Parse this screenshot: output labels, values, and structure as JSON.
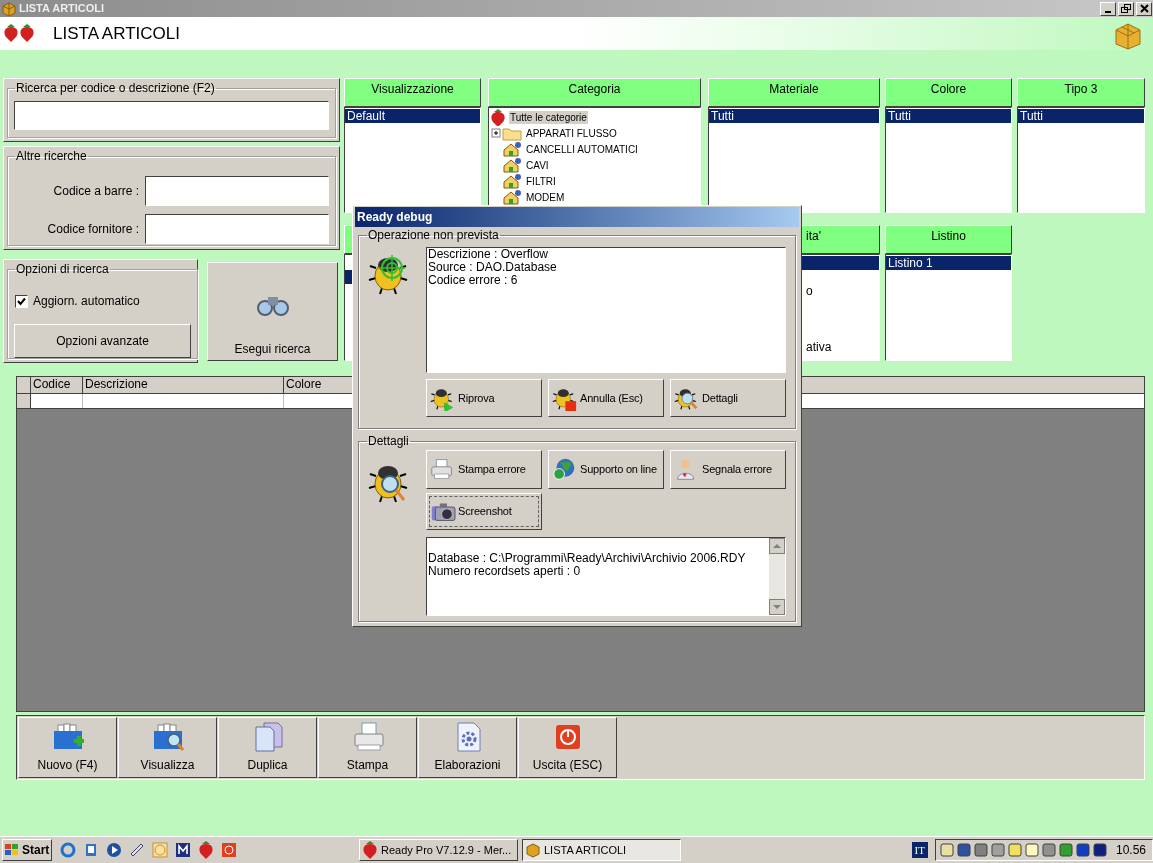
{
  "window": {
    "title": "LISTA ARTICOLI"
  },
  "header": {
    "title": "LISTA ARTICOLI"
  },
  "search": {
    "legend": "Ricerca per codice o descrizione (F2)"
  },
  "other_searches": {
    "legend": "Altre ricerche",
    "fields": [
      {
        "label": "Codice a barre :"
      },
      {
        "label": "Codice fornitore :"
      }
    ]
  },
  "search_options": {
    "legend": "Opzioni di ricerca",
    "auto_update": {
      "label": "Aggiorn. automatico",
      "checked": true
    },
    "advanced_button": "Opzioni avanzate"
  },
  "run_search_button": "Esegui ricerca",
  "filter_panels": [
    {
      "title": "Visualizzazione",
      "kind": "list",
      "items": [
        {
          "label": "Default",
          "selected": true
        }
      ]
    },
    {
      "title": "Categoria",
      "kind": "tree",
      "items": [
        {
          "label": "Tutte le categorie",
          "selected": true,
          "kind": "root",
          "children": [
            {
              "label": "APPARATI FLUSSO",
              "kind": "folder",
              "selected": false
            },
            {
              "label": "CANCELLI AUTOMATICI",
              "kind": "leaf",
              "selected": false
            },
            {
              "label": "CAVI",
              "kind": "leaf",
              "selected": false
            },
            {
              "label": "FILTRI",
              "kind": "leaf",
              "selected": false
            },
            {
              "label": "MODEM",
              "kind": "leaf",
              "selected": false
            }
          ]
        }
      ]
    },
    {
      "title": "Materiale",
      "kind": "list",
      "items": [
        {
          "label": "Tutti",
          "selected": true
        }
      ]
    },
    {
      "title": "Colore",
      "kind": "list",
      "items": [
        {
          "label": "Tutti",
          "selected": true
        }
      ]
    },
    {
      "title": "Tipo 3",
      "kind": "list",
      "items": [
        {
          "label": "Tutti",
          "selected": true
        }
      ]
    }
  ],
  "filter_panels_row_2": [
    {
      "kind": "list",
      "items": [
        {
          "selected": false
        },
        {
          "selected": true
        },
        {
          "selected": false
        },
        {
          "selected": false
        },
        {
          "selected": false
        }
      ]
    },
    {
      "kind": "hidden"
    },
    {
      "title": "ita'",
      "kind": "tail_list",
      "items": [
        {
          "selected": true
        },
        {
          "selected": false
        },
        {
          "label": "o",
          "selected": false
        },
        {
          "selected": false
        },
        {
          "selected": false
        },
        {
          "selected": false
        },
        {
          "label": "ativa",
          "selected": false
        }
      ]
    },
    {
      "title": "Listino",
      "kind": "list",
      "items": [
        {
          "label": "Listino 1",
          "selected": true
        }
      ]
    }
  ],
  "table": {
    "columns": [
      "Codice",
      "Descrizione",
      "Colore"
    ]
  },
  "toolbar": [
    {
      "label": "Nuovo (F4)",
      "kind": "new"
    },
    {
      "label": "Visualizza",
      "kind": "view"
    },
    {
      "label": "Duplica",
      "kind": "duplicate"
    },
    {
      "label": "Stampa",
      "kind": "print"
    },
    {
      "label": "Elaborazioni",
      "kind": "process"
    },
    {
      "label": "Uscita (ESC)",
      "kind": "exit"
    }
  ],
  "debug_dialog": {
    "title": "Ready debug",
    "error_group": {
      "legend": "Operazione non prevista",
      "lines": [
        "Descrizione : Overflow",
        "Source : DAO.Database",
        "Codice errore : 6"
      ],
      "buttons": [
        {
          "label": "Riprova",
          "kind": "retry",
          "focused": false
        },
        {
          "label": "Annulla (Esc)",
          "kind": "cancel",
          "focused": false
        },
        {
          "label": "Dettagli",
          "kind": "details",
          "focused": false
        }
      ]
    },
    "details_group": {
      "legend": "Dettagli",
      "buttons": [
        {
          "label": "Stampa errore",
          "kind": "print",
          "focused": false
        },
        {
          "label": "Supporto on line",
          "kind": "support",
          "focused": false
        },
        {
          "label": "Segnala errore",
          "kind": "report",
          "focused": false
        },
        {
          "label": "Screenshot",
          "kind": "camera",
          "focused": true
        }
      ],
      "lines": [
        "Database : C:\\Programmi\\Ready\\Archivi\\Archivio 2006.RDY",
        "Numero recordsets aperti : 0"
      ]
    }
  },
  "taskbar": {
    "start": "Start",
    "tasks": [
      {
        "label": "Ready Pro V7.12.9 - Mer...",
        "kind": "app",
        "selected": false
      },
      {
        "label": "LISTA ARTICOLI",
        "kind": "box",
        "selected": true
      }
    ],
    "language": "IT",
    "clock": "10.56"
  }
}
